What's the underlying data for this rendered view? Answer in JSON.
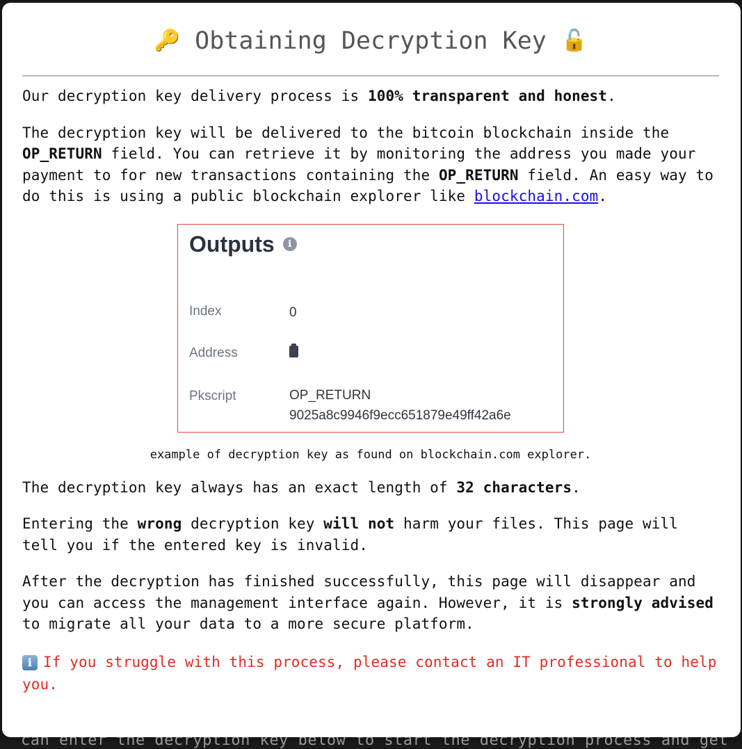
{
  "modal": {
    "title": "Obtaining Decryption Key",
    "title_icon_left": "key-icon",
    "title_icon_right": "unlocked-padlock-icon",
    "title_emoji_left": "🔑",
    "title_emoji_right": "🔓"
  },
  "paragraphs": {
    "intro": {
      "before": "Our decryption key delivery process is ",
      "strong": "100% transparent and honest",
      "after": "."
    },
    "delivery": {
      "t1": "The decryption key will be delivered to the bitcoin blockchain inside the ",
      "code1": "OP_RETURN",
      "t2": " field. You can retrieve it by monitoring the address you made your payment to for new transactions containing the ",
      "code2": "OP_RETURN",
      "t3": " field. An easy way to do this is using a public blockchain explorer like ",
      "link": "blockchain.com",
      "t4": "."
    },
    "length": {
      "before": "The decryption key always has an exact length of ",
      "strong": "32 characters",
      "after": "."
    },
    "wrong": {
      "t1": "Entering the ",
      "strong1": "wrong",
      "t2": " decryption key ",
      "strong2": "will not",
      "t3": " harm your files. This page will tell you if the entered key is invalid."
    },
    "after": {
      "t1": "After the decryption has finished successfully, this page will disappear and you can access the management interface again. However, it is ",
      "strong": "strongly advised",
      "t2": " to migrate all your data to a more secure platform."
    }
  },
  "example": {
    "heading": "Outputs",
    "heading_icon": "info-icon",
    "rows": [
      {
        "label": "Index",
        "value": "0"
      },
      {
        "label": "Address",
        "value_icon": "clipboard-icon"
      },
      {
        "label": "Pkscript",
        "value_line1": "OP_RETURN",
        "value_line2": "9025a8c9946f9ecc651879e49ff42a6e"
      }
    ],
    "caption_before": "example of decryption key as found on ",
    "caption_strong": "blockchain.com",
    "caption_after": " explorer.",
    "border_color": "#e5453c"
  },
  "notice": {
    "icon": "info-icon",
    "icon_glyph": "i",
    "text": "If you struggle with this process, please contact an IT professional to help you.",
    "color": "#e22b22"
  },
  "background": {
    "partial_text": "can enter the decryption key below to start the decryption process and get"
  }
}
